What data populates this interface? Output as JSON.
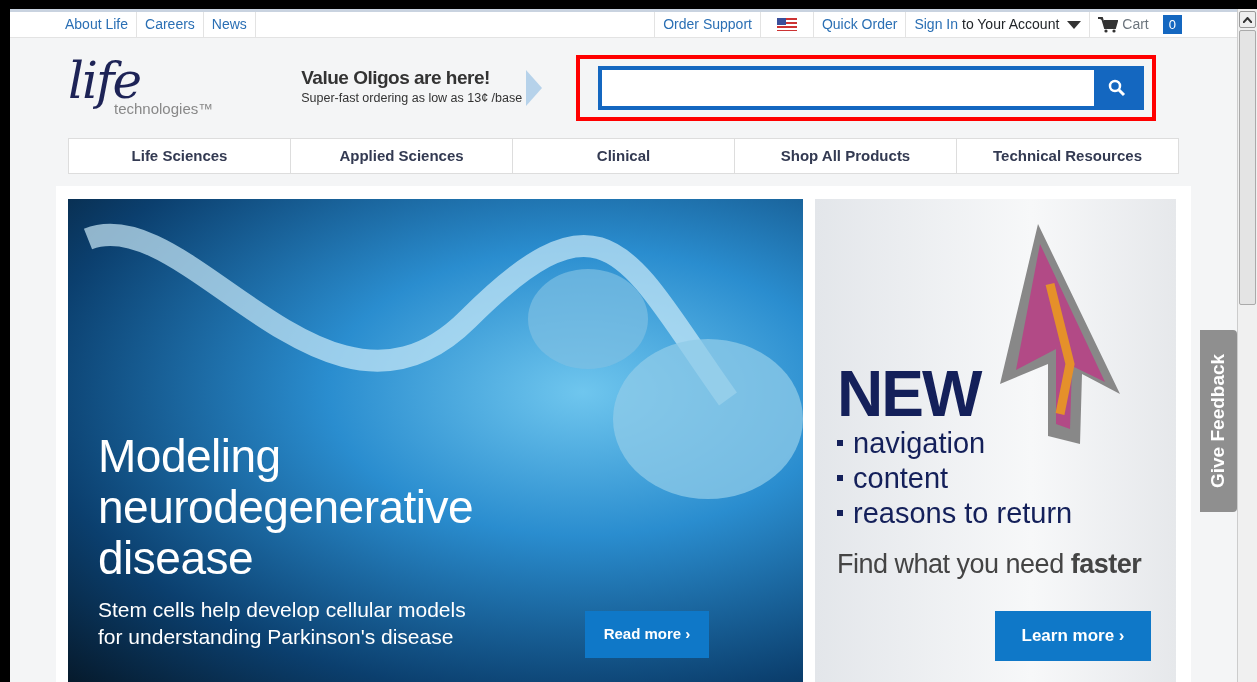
{
  "top_links": [
    {
      "label": "About Life"
    },
    {
      "label": "Careers"
    },
    {
      "label": "News"
    }
  ],
  "utility": {
    "order_support": "Order Support",
    "quick_order": "Quick Order",
    "sign_in": "Sign In",
    "account": "to Your Account",
    "cart": "Cart",
    "cart_count": "0"
  },
  "logo": {
    "script": "life",
    "name": "technologies™"
  },
  "promo": {
    "title": "Value Oligos are here!",
    "subtitle": "Super-fast ordering as low as 13¢ /base"
  },
  "search": {
    "highlighted": true
  },
  "nav": [
    {
      "label": "Life Sciences"
    },
    {
      "label": "Applied Sciences"
    },
    {
      "label": "Clinical"
    },
    {
      "label": "Shop All Products"
    },
    {
      "label": "Technical Resources"
    }
  ],
  "hero": {
    "headline": [
      "Modeling",
      "neurodegenerative",
      "disease"
    ],
    "body": [
      "Stem cells help develop cellular models",
      "for understanding Parkinson's disease"
    ],
    "button": "Read more ›"
  },
  "side_banner": {
    "title": "NEW",
    "bullets": [
      "navigation",
      "content",
      "reasons to return"
    ],
    "tagline": "Find what you need **faster**",
    "button": "Learn more ›"
  },
  "feedback": "Give Feedback"
}
